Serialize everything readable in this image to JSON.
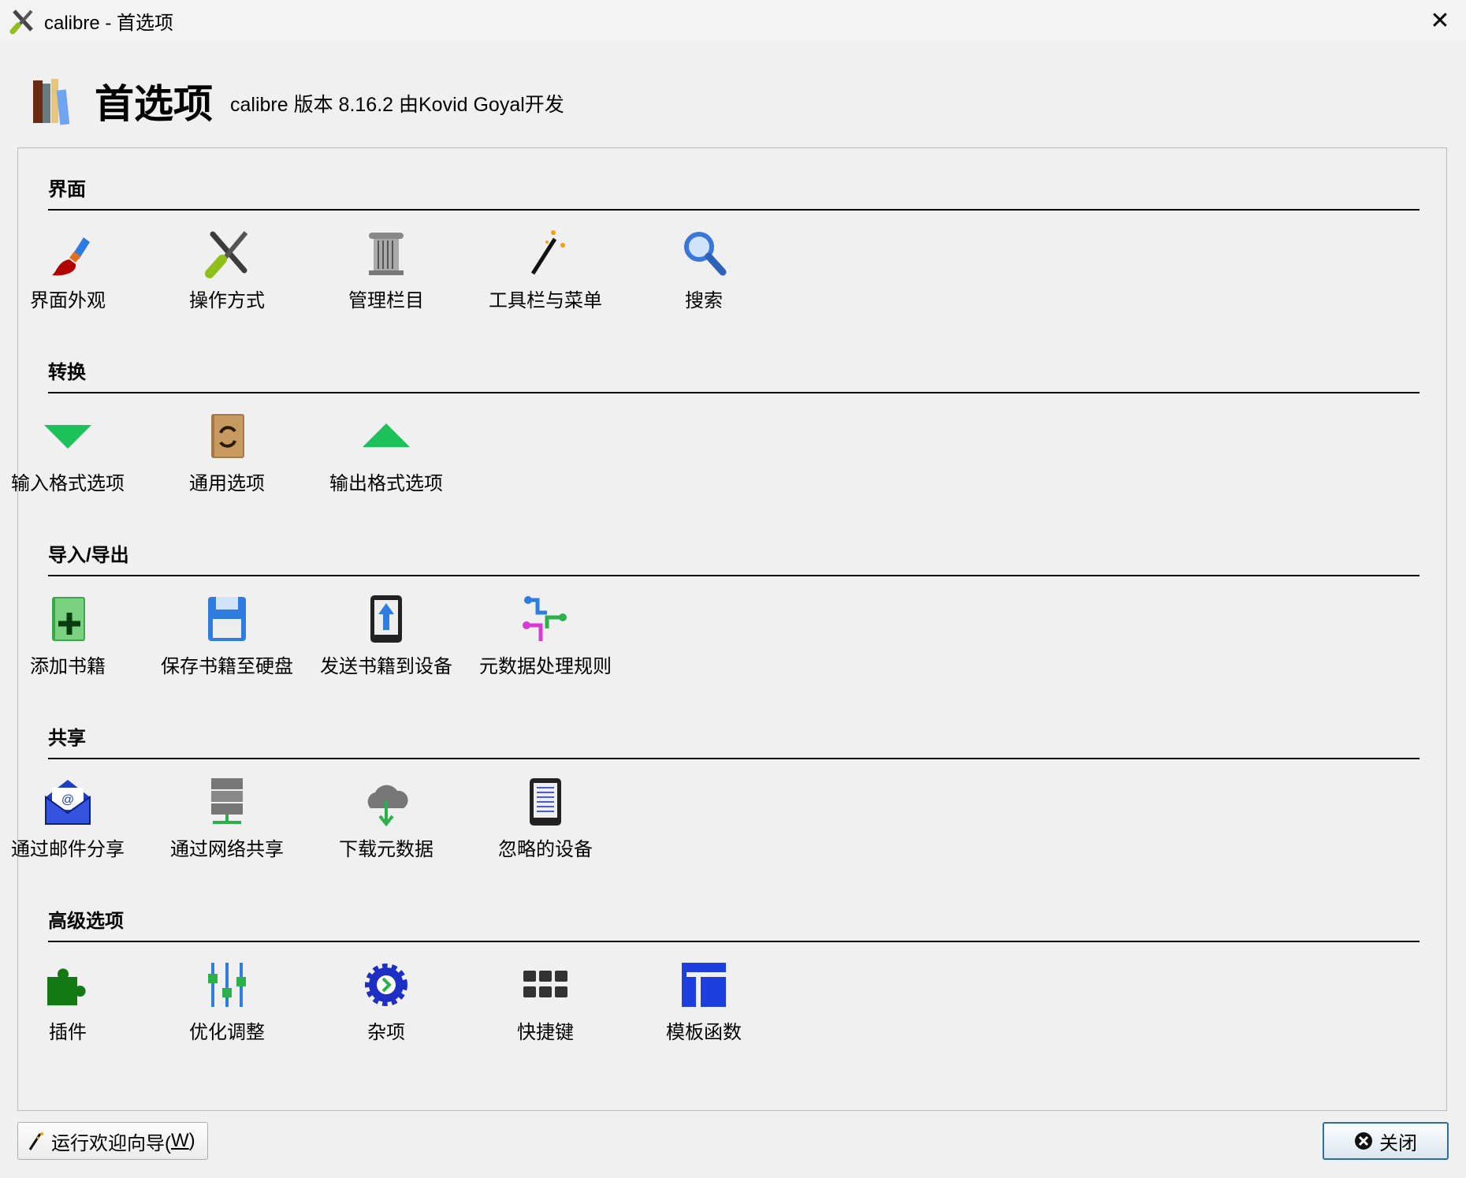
{
  "window": {
    "title": "calibre - 首选项",
    "close_glyph": "✕"
  },
  "header": {
    "title": "首选项",
    "subtitle": "calibre 版本 8.16.2 由Kovid Goyal开发"
  },
  "sections": [
    {
      "title": "界面",
      "items": [
        {
          "label": "界面外观",
          "icon": "paintbrush-icon"
        },
        {
          "label": "操作方式",
          "icon": "tools-icon"
        },
        {
          "label": "管理栏目",
          "icon": "column-icon"
        },
        {
          "label": "工具栏与菜单",
          "icon": "magic-wand-icon"
        },
        {
          "label": "搜索",
          "icon": "search-icon"
        }
      ]
    },
    {
      "title": "转换",
      "items": [
        {
          "label": "输入格式选项",
          "icon": "arrow-down-icon"
        },
        {
          "label": "通用选项",
          "icon": "convert-book-icon"
        },
        {
          "label": "输出格式选项",
          "icon": "arrow-up-icon"
        }
      ]
    },
    {
      "title": "导入/导出",
      "items": [
        {
          "label": "添加书籍",
          "icon": "add-book-icon"
        },
        {
          "label": "保存书籍至硬盘",
          "icon": "save-disk-icon"
        },
        {
          "label": "发送书籍到设备",
          "icon": "send-device-icon"
        },
        {
          "label": "元数据处理规则",
          "icon": "metadata-rules-icon"
        }
      ]
    },
    {
      "title": "共享",
      "items": [
        {
          "label": "通过邮件分享",
          "icon": "email-icon"
        },
        {
          "label": "通过网络共享",
          "icon": "server-icon"
        },
        {
          "label": "下载元数据",
          "icon": "cloud-download-icon"
        },
        {
          "label": "忽略的设备",
          "icon": "ereader-icon"
        }
      ]
    },
    {
      "title": "高级选项",
      "items": [
        {
          "label": "插件",
          "icon": "puzzle-icon"
        },
        {
          "label": "优化调整",
          "icon": "sliders-icon"
        },
        {
          "label": "杂项",
          "icon": "gear-icon"
        },
        {
          "label": "快捷键",
          "icon": "keyboard-icon"
        },
        {
          "label": "模板函数",
          "icon": "template-icon"
        }
      ]
    }
  ],
  "footer": {
    "wizard_label": "运行欢迎向导(",
    "wizard_key": "W",
    "wizard_end": ")",
    "close_label": "关闭"
  }
}
